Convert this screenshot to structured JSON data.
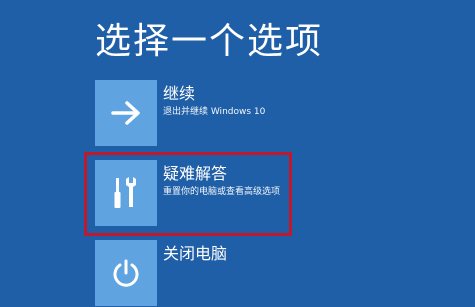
{
  "title": "选择一个选项",
  "options": [
    {
      "name": "继续",
      "description": "退出并继续 Windows 10",
      "icon": "arrow-right-icon"
    },
    {
      "name": "疑难解答",
      "description": "重置你的电脑或查看高级选项",
      "icon": "tools-icon"
    },
    {
      "name": "关闭电脑",
      "description": "",
      "icon": "power-icon"
    }
  ],
  "colors": {
    "background": "#1f5fa8",
    "tile": "#5fa4e0",
    "highlight": "#c0182c"
  }
}
